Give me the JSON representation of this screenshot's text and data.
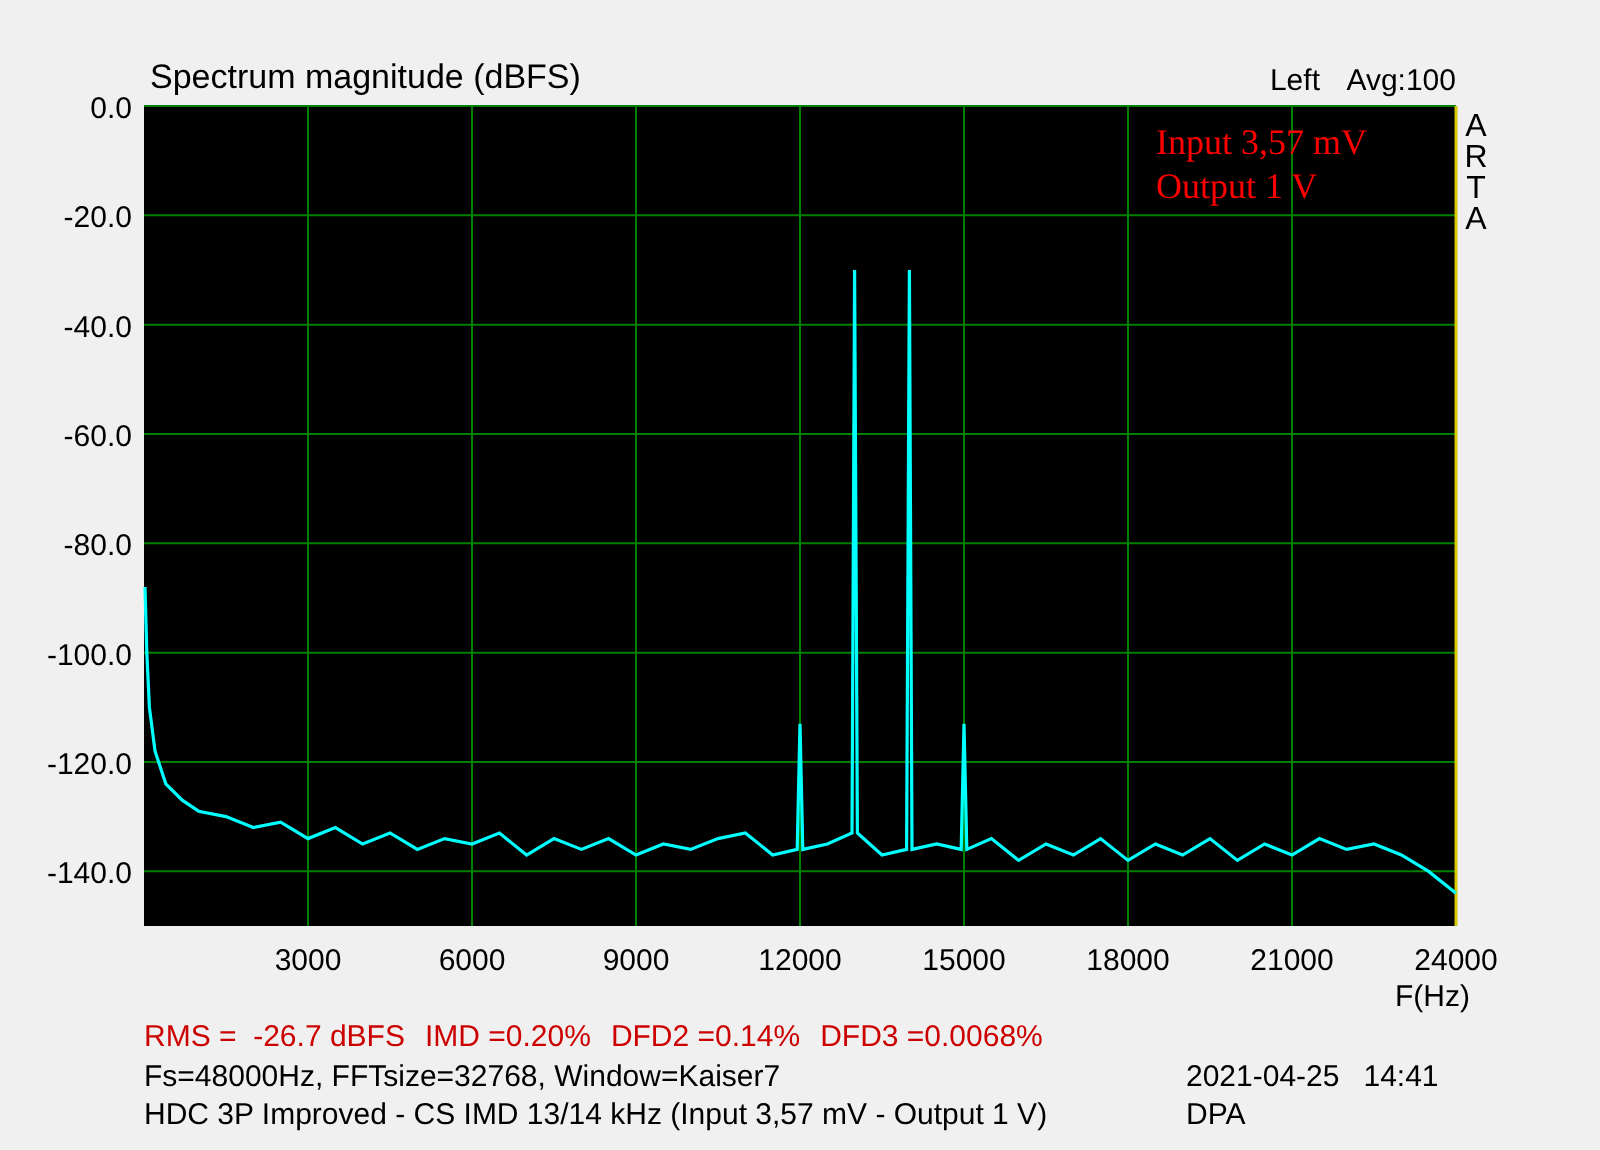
{
  "chart": {
    "average": "Avg:100",
    "brand": "ARTA",
    "chart_data": {
      "type": "line",
      "title": "Spectrum magnitude (dBFS)",
      "xlabel": "F(Hz)",
      "grid": true,
      "xlim": [
        0,
        24000
      ],
      "ylim": [
        -150,
        0
      ],
      "xticks": [
        3000,
        6000,
        9000,
        12000,
        15000,
        18000,
        21000,
        24000
      ],
      "yticks": [
        {
          "value": 0,
          "label": "0.0"
        },
        {
          "value": -20,
          "label": "-20.0"
        },
        {
          "value": -40,
          "label": "-40.0"
        },
        {
          "value": -60,
          "label": "-60.0"
        },
        {
          "value": -80,
          "label": "-80.0"
        },
        {
          "value": -100,
          "label": "-100.0"
        },
        {
          "value": -120,
          "label": "-120.0"
        },
        {
          "value": -140,
          "label": "-140.0"
        }
      ],
      "x": [
        20,
        50,
        100,
        200,
        400,
        700,
        1000,
        1500,
        2000,
        2500,
        3000,
        3500,
        4000,
        4500,
        5000,
        5500,
        6000,
        6500,
        7000,
        7500,
        8000,
        8500,
        9000,
        9500,
        10000,
        10500,
        11000,
        11500,
        11950,
        12000,
        12050,
        12500,
        12950,
        13000,
        13050,
        13500,
        13950,
        14000,
        14050,
        14500,
        14950,
        15000,
        15050,
        15500,
        16000,
        16500,
        17000,
        17500,
        18000,
        18500,
        19000,
        19500,
        20000,
        20500,
        21000,
        21500,
        22000,
        22500,
        23000,
        23500,
        24000
      ],
      "series": [
        {
          "name": "Left",
          "color": "#00ffff",
          "values": [
            -88,
            -100,
            -110,
            -118,
            -124,
            -127,
            -129,
            -130,
            -132,
            -131,
            -134,
            -132,
            -135,
            -133,
            -136,
            -134,
            -135,
            -133,
            -137,
            -134,
            -136,
            -134,
            -137,
            -135,
            -136,
            -134,
            -133,
            -137,
            -136,
            -113,
            -136,
            -135,
            -133,
            -30,
            -133,
            -137,
            -136,
            -30,
            -136,
            -135,
            -136,
            -113,
            -136,
            -134,
            -138,
            -135,
            -137,
            -134,
            -138,
            -135,
            -137,
            -134,
            -138,
            -135,
            -137,
            -134,
            -136,
            -135,
            -137,
            -140,
            -144
          ]
        }
      ],
      "annotations": [
        "Input 3,57 mV",
        "Output 1 V"
      ]
    }
  },
  "measurements": [
    "RMS =  -26.7 dBFS",
    "IMD =0.20%",
    "DFD2 =0.14%",
    "DFD3 =0.0068%"
  ],
  "settings": "Fs=48000Hz, FFTsize=32768, Window=Kaiser7",
  "date": "2021-04-25",
  "time": "14:41",
  "description": "HDC 3P Improved - CS IMD 13/14 kHz (Input 3,57 mV - Output 1 V)",
  "author": "DPA"
}
